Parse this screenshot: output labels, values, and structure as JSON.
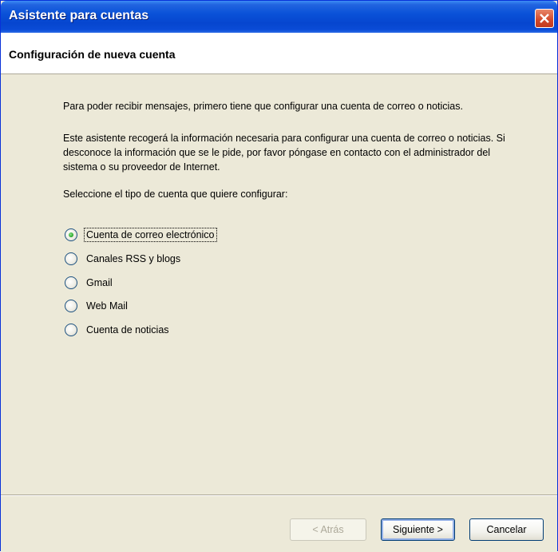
{
  "window": {
    "title": "Asistente para cuentas"
  },
  "header": {
    "title": "Configuración de nueva cuenta"
  },
  "body": {
    "intro": "Para poder recibir mensajes, primero tiene que configurar una cuenta de correo o noticias.",
    "description": "Este asistente recogerá la información necesaria para configurar una cuenta de correo o noticias. Si desconoce la información que se le pide, por favor póngase en contacto con el administrador del sistema o su proveedor de Internet.",
    "prompt": "Seleccione el tipo de cuenta que quiere configurar:"
  },
  "account_types": [
    {
      "label": "Cuenta de correo electrónico",
      "selected": true
    },
    {
      "label": "Canales RSS y blogs",
      "selected": false
    },
    {
      "label": "Gmail",
      "selected": false
    },
    {
      "label": "Web Mail",
      "selected": false
    },
    {
      "label": "Cuenta de noticias",
      "selected": false
    }
  ],
  "buttons": {
    "back": "< Atrás",
    "next": "Siguiente >",
    "cancel": "Cancelar"
  }
}
